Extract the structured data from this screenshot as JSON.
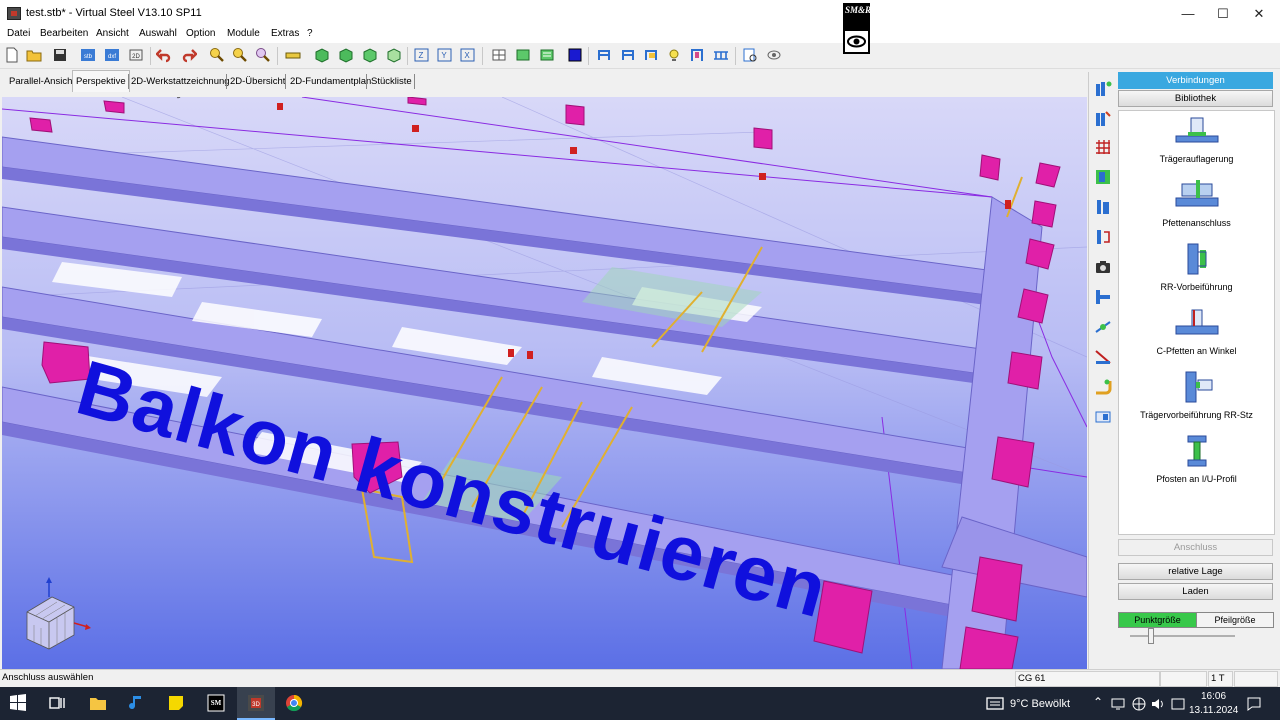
{
  "window": {
    "title": "test.stb* - Virtual Steel V13.10 SP11",
    "controls": {
      "minimize": "—",
      "maximize": "☐",
      "close": "✕"
    }
  },
  "logo": {
    "letters": "SM&R"
  },
  "menu": [
    "Datei",
    "Bearbeiten",
    "Ansicht",
    "Auswahl",
    "Option",
    "Module",
    "Extras",
    "?"
  ],
  "tabs": [
    {
      "label": "Parallel-Ansicht"
    },
    {
      "label": "Perspektive",
      "active": true
    },
    {
      "label": "2D-Werkstattzeichnung"
    },
    {
      "label": "2D-Übersicht"
    },
    {
      "label": "2D-Fundamentplan"
    },
    {
      "label": "Stückliste"
    }
  ],
  "viewport": {
    "overlay_text": "Balkon konstruieren",
    "colors": {
      "beam": "#a5a0f0",
      "beam_dark": "#7a74d8",
      "support": "#e020a8",
      "background_top": "#d8d8f8",
      "background_bottom": "#5b6fe6"
    }
  },
  "right_panel": {
    "verbindungen": "Verbindungen",
    "bibliothek": "Bibliothek",
    "library": [
      {
        "label": "Trägerauflagerung",
        "icon": "beam-support-icon"
      },
      {
        "label": "Pfettenanschluss",
        "icon": "purlin-connection-icon"
      },
      {
        "label": "RR-Vorbeiführung",
        "icon": "tube-bypass-icon"
      },
      {
        "label": "C-Pfetten an Winkel",
        "icon": "c-purlin-angle-icon"
      },
      {
        "label": "Trägervorbeiführung RR-Stz",
        "icon": "beam-bypass-icon"
      },
      {
        "label": "Pfosten an I/U-Profil",
        "icon": "post-profile-icon"
      }
    ],
    "anschluss": "Anschluss",
    "relative_lage": "relative Lage",
    "laden": "Laden",
    "punktgroesse": "Punktgröße",
    "pfeilgroesse": "Pfeilgröße"
  },
  "status": {
    "message": "Anschluss auswählen",
    "cg": "CG 61",
    "unit": "1 T"
  },
  "taskbar": {
    "weather": "9°C  Bewölkt",
    "time": "16:06",
    "date": "13.11.2024"
  }
}
